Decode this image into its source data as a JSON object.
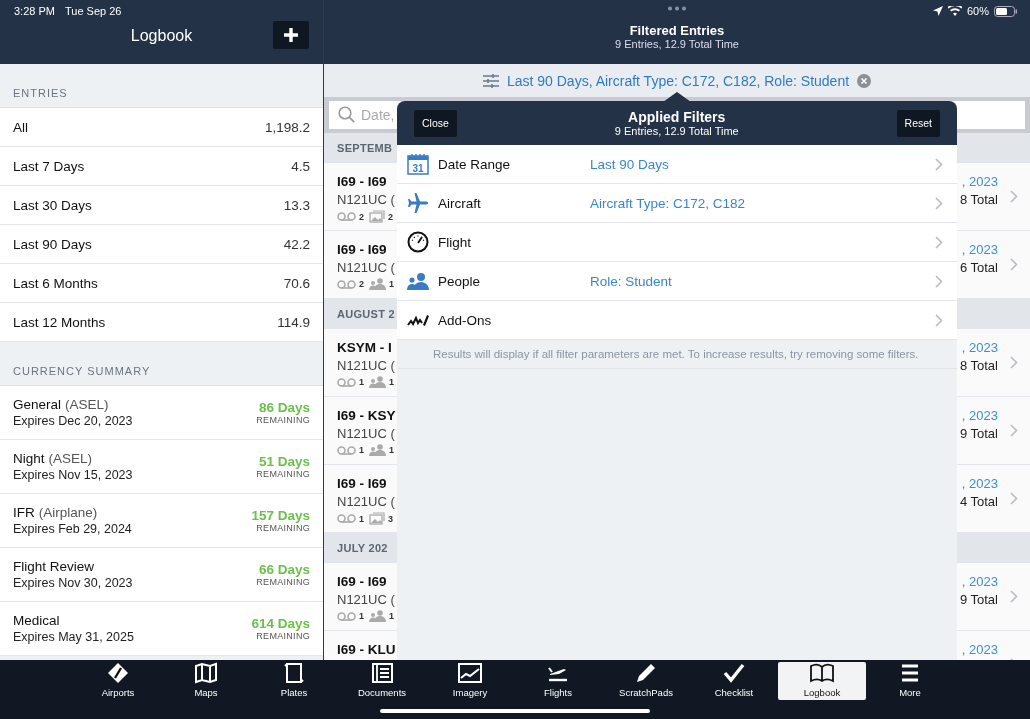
{
  "status_bar": {
    "time": "3:28 PM",
    "date": "Tue Sep 26",
    "battery": "60%"
  },
  "sidebar": {
    "title": "Logbook",
    "entries_heading": "ENTRIES",
    "entries": [
      {
        "label": "All",
        "value": "1,198.2",
        "selected": false
      },
      {
        "label": "Last 7 Days",
        "value": "4.5",
        "selected": false
      },
      {
        "label": "Last 30 Days",
        "value": "13.3",
        "selected": false
      },
      {
        "label": "Last 90 Days",
        "value": "42.2",
        "selected": false
      },
      {
        "label": "Last 6 Months",
        "value": "70.6",
        "selected": false
      },
      {
        "label": "Last 12 Months",
        "value": "114.9",
        "selected": false
      }
    ],
    "currency_heading": "CURRENCY SUMMARY",
    "currency": [
      {
        "name": "General",
        "qualifier": "(ASEL)",
        "expires": "Expires Dec 20, 2023",
        "days": "86 Days",
        "remaining": "REMAINING"
      },
      {
        "name": "Night",
        "qualifier": "(ASEL)",
        "expires": "Expires Nov 15, 2023",
        "days": "51 Days",
        "remaining": "REMAINING"
      },
      {
        "name": "IFR",
        "qualifier": "(Airplane)",
        "expires": "Expires Feb 29, 2024",
        "days": "157 Days",
        "remaining": "REMAINING"
      },
      {
        "name": "Flight Review",
        "expires": "Expires Nov 30, 2023",
        "days": "66 Days",
        "remaining": "REMAINING"
      },
      {
        "name": "Medical",
        "expires": "Expires May 31, 2025",
        "days": "614 Days",
        "remaining": "REMAINING"
      }
    ]
  },
  "main": {
    "title": "Filtered Entries",
    "subtitle": "9 Entries, 12.9 Total Time",
    "filter_summary": "Last 90 Days, Aircraft Type: C172, C182, Role: Student",
    "search": {
      "placeholder": "Date,"
    },
    "sections": [
      {
        "heading": "SEPTEMB",
        "rows": [
          {
            "route": "I69 - I69",
            "aircraft": "N121UC (",
            "badges": [
              {
                "kind": "recording",
                "count": "2"
              },
              {
                "kind": "photos",
                "count": "2"
              }
            ],
            "date": ", 2023",
            "total": "8 Total"
          },
          {
            "route": "I69 - I69",
            "aircraft": "N121UC (",
            "badges": [
              {
                "kind": "recording",
                "count": "2"
              },
              {
                "kind": "people",
                "count": "1"
              }
            ],
            "date": ", 2023",
            "total": "6 Total"
          }
        ]
      },
      {
        "heading": "AUGUST 2",
        "rows": [
          {
            "route": "KSYM - I",
            "aircraft": "N121UC (",
            "badges": [
              {
                "kind": "recording",
                "count": "1"
              },
              {
                "kind": "people",
                "count": "1"
              }
            ],
            "date": ", 2023",
            "total": "8 Total"
          },
          {
            "route": "I69 - KSY",
            "aircraft": "N121UC (",
            "badges": [
              {
                "kind": "recording",
                "count": "1"
              },
              {
                "kind": "people",
                "count": "1"
              }
            ],
            "date": ", 2023",
            "total": "9 Total"
          },
          {
            "route": "I69 - I69",
            "aircraft": "N121UC (",
            "badges": [
              {
                "kind": "recording",
                "count": "1"
              },
              {
                "kind": "photos",
                "count": "3"
              }
            ],
            "date": ", 2023",
            "total": "4 Total"
          }
        ]
      },
      {
        "heading": "JULY 202",
        "rows": [
          {
            "route": "I69 - I69",
            "aircraft": "N121UC (",
            "badges": [
              {
                "kind": "recording",
                "count": "1"
              },
              {
                "kind": "people",
                "count": "1"
              }
            ],
            "date": ", 2023",
            "total": "9 Total"
          },
          {
            "route": "I69 - KLU",
            "date": ", 2023"
          }
        ]
      }
    ]
  },
  "popover": {
    "title": "Applied Filters",
    "subtitle": "9 Entries, 12.9 Total Time",
    "close": "Close",
    "reset": "Reset",
    "filters": [
      {
        "kind": "date",
        "label": "Date Range",
        "value": "Last 90 Days",
        "icon_label": "31"
      },
      {
        "kind": "aircraft",
        "label": "Aircraft",
        "value": "Aircraft Type: C172, C182"
      },
      {
        "kind": "flight",
        "label": "Flight"
      },
      {
        "kind": "people",
        "label": "People",
        "value": "Role: Student"
      },
      {
        "kind": "addons",
        "label": "Add-Ons"
      }
    ],
    "note": "Results will display if all filter parameters are met.  To increase results, try removing some filters."
  },
  "tab_bar": [
    {
      "kind": "airports",
      "label": "Airports",
      "selected": false
    },
    {
      "kind": "maps",
      "label": "Maps",
      "selected": false
    },
    {
      "kind": "plates",
      "label": "Plates",
      "selected": false
    },
    {
      "kind": "documents",
      "label": "Documents",
      "selected": false
    },
    {
      "kind": "imagery",
      "label": "Imagery",
      "selected": false
    },
    {
      "kind": "flights",
      "label": "Flights",
      "selected": false
    },
    {
      "kind": "scratchpads",
      "label": "ScratchPads",
      "selected": false
    },
    {
      "kind": "checklist",
      "label": "Checklist",
      "selected": false
    },
    {
      "kind": "logbook",
      "label": "Logbook",
      "selected": true
    },
    {
      "kind": "more",
      "label": "More",
      "selected": false
    }
  ]
}
